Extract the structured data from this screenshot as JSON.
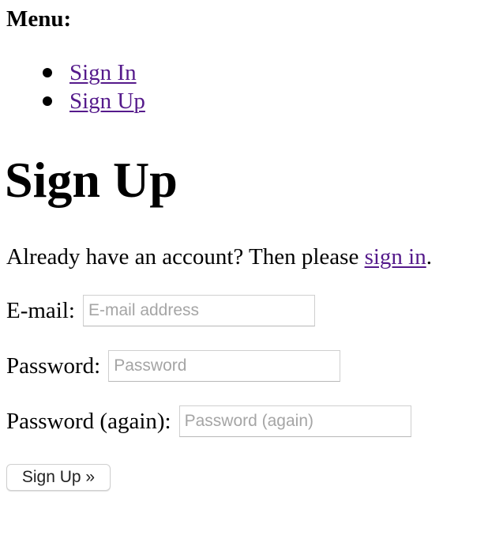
{
  "menu": {
    "heading": "Menu:",
    "items": [
      {
        "label": "Sign In"
      },
      {
        "label": "Sign Up"
      }
    ]
  },
  "main": {
    "title": "Sign Up",
    "intro": {
      "prefix": "Already have an account? Then please ",
      "link_text": "sign in",
      "suffix": "."
    }
  },
  "form": {
    "email": {
      "label": "E-mail:",
      "placeholder": "E-mail address",
      "value": ""
    },
    "password": {
      "label": "Password:",
      "placeholder": "Password",
      "value": ""
    },
    "password_again": {
      "label": "Password (again):",
      "placeholder": "Password (again)",
      "value": ""
    },
    "submit_label": "Sign Up »"
  },
  "colors": {
    "link": "#551a8b",
    "placeholder": "#a5a5a5",
    "input_border": "#cfcfcf"
  }
}
